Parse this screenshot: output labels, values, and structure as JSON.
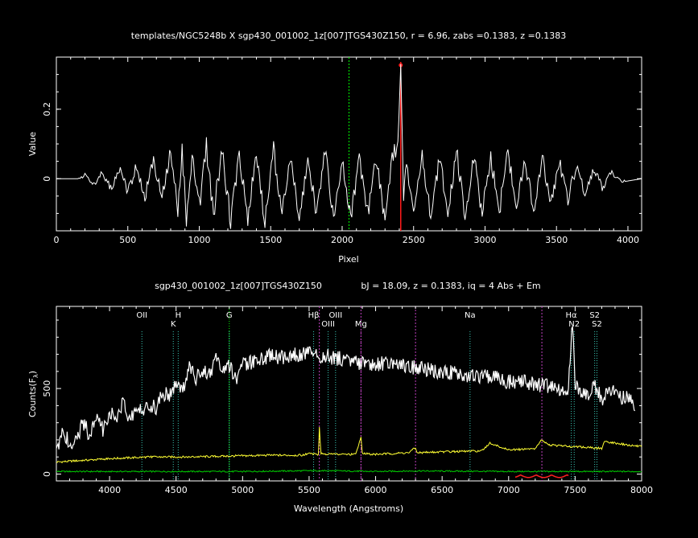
{
  "colors": {
    "background": "#000000",
    "foreground": "#ffffff",
    "peak": "#ff1a1a",
    "template_line": "#00ff00",
    "abs_line": "#3ac9b6",
    "em_line": "#c040c0",
    "sky": "#ffff33",
    "error": "#00cc00",
    "residual": "#ff2020"
  },
  "chart_data": [
    {
      "type": "line",
      "title": "templates/NGC5248b X sgp430_001002_1z[007]TGS430Z150, r =  6.96, zabs =0.1383, z =0.1383",
      "xlabel": "Pixel",
      "ylabel": "Value",
      "xlim": [
        0,
        4096
      ],
      "ylim": [
        -0.15,
        0.35
      ],
      "xticks": [
        0,
        500,
        1000,
        1500,
        2000,
        2500,
        3000,
        3500,
        4000
      ],
      "yticks": [
        0,
        0.2
      ],
      "ytick_labels": [
        "0",
        "0.2"
      ],
      "grid": false,
      "series": [
        {
          "x": [
            0,
            150,
            200,
            260,
            320,
            380,
            440,
            500,
            560,
            620,
            680,
            740,
            800,
            850,
            880,
            910,
            950,
            1000,
            1050,
            1100,
            1160,
            1220,
            1280,
            1340,
            1400,
            1460,
            1520,
            1580,
            1640,
            1700,
            1760,
            1820,
            1880,
            1940,
            2000,
            2060,
            2120,
            2180,
            2240,
            2300,
            2350,
            2390,
            2410,
            2430,
            2450,
            2500,
            2560,
            2620,
            2680,
            2740,
            2800,
            2860,
            2920,
            2980,
            3040,
            3100,
            3160,
            3220,
            3280,
            3340,
            3400,
            3460,
            3520,
            3580,
            3640,
            3700,
            3760,
            3820,
            3880,
            3950,
            4096
          ],
          "y": [
            0,
            0,
            0.01,
            -0.02,
            0.02,
            -0.03,
            0.03,
            -0.04,
            0.04,
            -0.05,
            0.05,
            -0.06,
            0.08,
            -0.1,
            0.1,
            -0.13,
            0.06,
            -0.08,
            0.1,
            -0.1,
            0.08,
            -0.12,
            0.07,
            -0.11,
            0.07,
            -0.13,
            0.08,
            -0.1,
            0.06,
            -0.12,
            0.06,
            -0.1,
            0.08,
            -0.12,
            0.05,
            -0.11,
            0.06,
            -0.1,
            0.06,
            -0.13,
            0.07,
            0.09,
            0.33,
            -0.05,
            0.04,
            -0.1,
            0.07,
            -0.12,
            0.06,
            -0.09,
            0.08,
            -0.11,
            0.07,
            -0.1,
            0.06,
            -0.09,
            0.07,
            -0.08,
            0.06,
            -0.1,
            0.06,
            -0.07,
            0.05,
            -0.06,
            0.04,
            -0.05,
            0.03,
            -0.03,
            0.02,
            -0.01,
            0
          ]
        }
      ],
      "markers": {
        "template_reference_pixel": 2048,
        "peak_pixel": 2410
      }
    },
    {
      "type": "line",
      "title": "sgp430_001002_1z[007]TGS430Z150",
      "subtitle": "bJ = 18.09, z = 0.1383, iq =  4 Abs + Em",
      "xlabel": "Wavelength (Angstroms)",
      "ylabel": "Counts(F",
      "ylabel_subscript": "λ",
      "ylabel_close": ")",
      "xlim": [
        3600,
        8000
      ],
      "ylim": [
        -40,
        980
      ],
      "xticks": [
        4000,
        4500,
        5000,
        5500,
        6000,
        6500,
        7000,
        7500,
        8000
      ],
      "yticks": [
        0,
        500
      ],
      "grid": false,
      "series": [
        {
          "name": "",
          "x": [
            3600,
            3650,
            3700,
            3750,
            3800,
            3850,
            3900,
            3950,
            4000,
            4050,
            4100,
            4150,
            4200,
            4250,
            4300,
            4350,
            4400,
            4450,
            4500,
            4550,
            4600,
            4650,
            4700,
            4750,
            4800,
            4850,
            4900,
            4950,
            5000,
            5100,
            5200,
            5300,
            5400,
            5500,
            5600,
            5700,
            5800,
            5900,
            6000,
            6100,
            6200,
            6300,
            6400,
            6500,
            6600,
            6700,
            6800,
            6900,
            7000,
            7100,
            7200,
            7300,
            7400,
            7450,
            7480,
            7500,
            7550,
            7600,
            7650,
            7700,
            7750,
            7800,
            7850,
            7900,
            7950
          ],
          "y": [
            150,
            250,
            180,
            200,
            300,
            230,
            330,
            260,
            370,
            320,
            420,
            300,
            390,
            350,
            410,
            380,
            480,
            450,
            520,
            470,
            650,
            560,
            600,
            580,
            680,
            600,
            630,
            550,
            640,
            660,
            690,
            680,
            700,
            710,
            690,
            680,
            660,
            650,
            640,
            650,
            630,
            620,
            610,
            600,
            590,
            580,
            570,
            560,
            540,
            540,
            520,
            510,
            480,
            510,
            900,
            520,
            480,
            470,
            510,
            440,
            480,
            500,
            450,
            460,
            370
          ]
        },
        {
          "name": "",
          "x": [
            3600,
            3800,
            4000,
            4300,
            4600,
            4900,
            5200,
            5450,
            5500,
            5570,
            5577,
            5590,
            5700,
            5850,
            5890,
            5900,
            6000,
            6250,
            6300,
            6310,
            6500,
            6800,
            6860,
            7000,
            7200,
            7250,
            7300,
            7500,
            7700,
            7720,
            7900,
            8000
          ],
          "y": [
            70,
            80,
            90,
            100,
            100,
            105,
            110,
            110,
            120,
            115,
            270,
            120,
            115,
            115,
            220,
            120,
            115,
            125,
            155,
            125,
            130,
            135,
            180,
            140,
            150,
            200,
            170,
            160,
            150,
            190,
            170,
            160
          ]
        },
        {
          "name": "",
          "x": [
            3600,
            4000,
            5000,
            5577,
            6000,
            6300,
            7000,
            7500,
            8000
          ],
          "y": [
            15,
            15,
            15,
            20,
            15,
            18,
            15,
            15,
            15
          ]
        }
      ],
      "reference_lines": [
        {
          "label": "OII",
          "x": 4243,
          "kind": "abs"
        },
        {
          "label": "K",
          "x": 4479,
          "kind": "abs"
        },
        {
          "label": "H",
          "x": 4516,
          "kind": "abs"
        },
        {
          "label": "G",
          "x": 4900,
          "kind": "abs"
        },
        {
          "label": "Hβ",
          "x": 5534,
          "kind": "abs"
        },
        {
          "label": "OIII",
          "x": 5643,
          "kind": "abs"
        },
        {
          "label": "OIII",
          "x": 5699,
          "kind": "abs"
        },
        {
          "label": "Mg",
          "x": 5890,
          "kind": "em"
        },
        {
          "label": "Na",
          "x": 6710,
          "kind": "abs"
        },
        {
          "label": "Hα",
          "x": 7471,
          "kind": "abs"
        },
        {
          "label": "N2",
          "x": 7493,
          "kind": "abs"
        },
        {
          "label": "S2",
          "x": 7647,
          "kind": "abs"
        },
        {
          "label": "S2",
          "x": 7664,
          "kind": "abs"
        }
      ],
      "sky_lines": [
        5577,
        5890,
        6300,
        7250
      ],
      "sky_line_labels_unprinted": true
    }
  ]
}
